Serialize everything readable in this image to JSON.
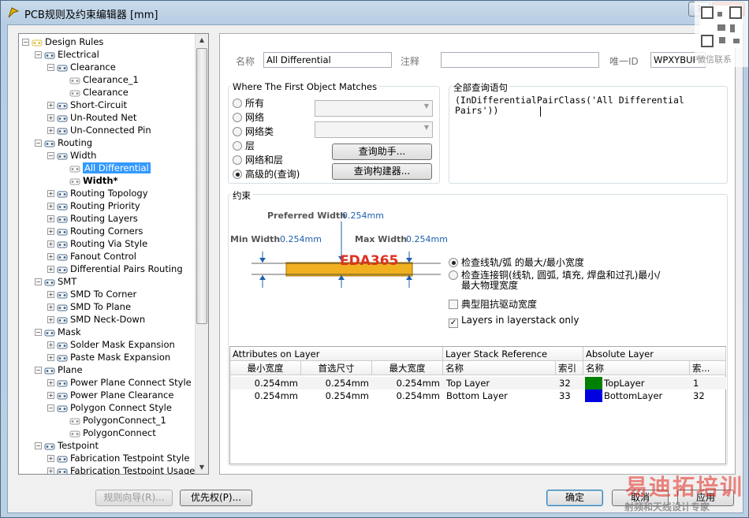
{
  "window": {
    "title": "PCB规则及约束编辑器 [mm]",
    "controls": {
      "help": "?",
      "close": "X"
    }
  },
  "tree": {
    "nodes": [
      {
        "label": "Design Rules"
      },
      {
        "label": "Electrical"
      },
      {
        "label": "Clearance"
      },
      {
        "label": "Clearance_1"
      },
      {
        "label": "Clearance"
      },
      {
        "label": "Short-Circuit"
      },
      {
        "label": "Un-Routed Net"
      },
      {
        "label": "Un-Connected Pin"
      },
      {
        "label": "Routing"
      },
      {
        "label": "Width"
      },
      {
        "label": "All Differential"
      },
      {
        "label": "Width*"
      },
      {
        "label": "Routing Topology"
      },
      {
        "label": "Routing Priority"
      },
      {
        "label": "Routing Layers"
      },
      {
        "label": "Routing Corners"
      },
      {
        "label": "Routing Via Style"
      },
      {
        "label": "Fanout Control"
      },
      {
        "label": "Differential Pairs Routing"
      },
      {
        "label": "SMT"
      },
      {
        "label": "SMD To Corner"
      },
      {
        "label": "SMD To Plane"
      },
      {
        "label": "SMD Neck-Down"
      },
      {
        "label": "Mask"
      },
      {
        "label": "Solder Mask Expansion"
      },
      {
        "label": "Paste Mask Expansion"
      },
      {
        "label": "Plane"
      },
      {
        "label": "Power Plane Connect Style"
      },
      {
        "label": "Power Plane Clearance"
      },
      {
        "label": "Polygon Connect Style"
      },
      {
        "label": "PolygonConnect_1"
      },
      {
        "label": "PolygonConnect"
      },
      {
        "label": "Testpoint"
      },
      {
        "label": "Fabrication Testpoint Style"
      },
      {
        "label": "Fabrication Testpoint Usage"
      }
    ]
  },
  "rule": {
    "name_label": "名称",
    "name_value": "All Differential",
    "comment_label": "注释",
    "comment_value": "",
    "uid_label": "唯一ID",
    "uid_value": "WPXYBUPY"
  },
  "match": {
    "title": "Where The First Object Matches",
    "options": [
      "所有",
      "网络",
      "网络类",
      "层",
      "网络和层",
      "高级的(查询)"
    ],
    "selected": "高级的(查询)",
    "helper_button": "查询助手...",
    "builder_button": "查询构建器..."
  },
  "full_query": {
    "title": "全部查询语句",
    "text": "(InDifferentialPairClass('All Differential Pairs'))"
  },
  "constraints": {
    "title": "约束",
    "preferred_label": "Preferred Width",
    "preferred_value": "0.254mm",
    "min_label": "Min Width",
    "min_value": "0.254mm",
    "max_label": "Max Width",
    "max_value": "0.254mm",
    "radio1": "检查线轨/弧 的最大/最小宽度",
    "radio2_line1": "检查连接铜(线轨, 圆弧, 填充, 焊盘和过孔)最小/",
    "radio2_line2": "最大物理宽度",
    "check1": "典型阻抗驱动宽度",
    "check2": "Layers in layerstack only",
    "trace_color": "#f0b020"
  },
  "grid": {
    "group_headers": [
      "Attributes on Layer",
      "Layer Stack Reference",
      "Absolute Layer"
    ],
    "col_headers": [
      "最小宽度",
      "首选尺寸",
      "最大宽度",
      "名称",
      "索引",
      "名称",
      "索..."
    ],
    "rows": [
      {
        "min": "0.254mm",
        "pref": "0.254mm",
        "max": "0.254mm",
        "name": "Top Layer",
        "index": "32",
        "color": "#008000",
        "abs_name": "TopLayer",
        "abs_index": "1"
      },
      {
        "min": "0.254mm",
        "pref": "0.254mm",
        "max": "0.254mm",
        "name": "Bottom Layer",
        "index": "33",
        "color": "#0000e0",
        "abs_name": "BottomLayer",
        "abs_index": "32"
      }
    ]
  },
  "footer": {
    "wizard_button": "规则向导(R)...",
    "priority_button": "优先权(P)...",
    "ok_button": "确定",
    "cancel_button": "取消",
    "apply_button": "应用"
  },
  "watermarks": {
    "eda": "EDA365",
    "brand": "易迪拓培训",
    "brand_sub": "射频和天线设计专家",
    "qr_text": "微信联系"
  }
}
